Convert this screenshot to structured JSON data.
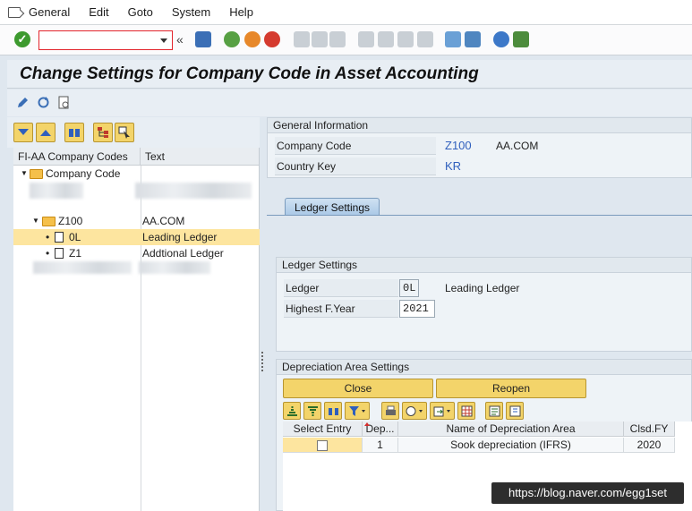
{
  "menu": [
    "General",
    "Edit",
    "Goto",
    "System",
    "Help"
  ],
  "command_field": {
    "value": ""
  },
  "title": "Change Settings for Company Code in Asset Accounting",
  "tree": {
    "headers": [
      "FI-AA Company Codes",
      "Text"
    ],
    "root_label": "Company Code",
    "nodes": [
      {
        "label": "Z100",
        "text": "AA.COM"
      },
      {
        "label": "0L",
        "text": "Leading Ledger"
      },
      {
        "label": "Z1",
        "text": "Addtional Ledger"
      }
    ]
  },
  "general_info": {
    "title": "General Information",
    "company_code_label": "Company Code",
    "company_code": "Z100",
    "company_name": "AA.COM",
    "country_key_label": "Country Key",
    "country_key": "KR"
  },
  "tab": {
    "label": "Ledger Settings"
  },
  "ledger_settings": {
    "title": "Ledger Settings",
    "ledger_label": "Ledger",
    "ledger_value": "0L",
    "ledger_text": "Leading Ledger",
    "fyear_label": "Highest F.Year",
    "fyear_value": "2021"
  },
  "depreciation": {
    "title": "Depreciation Area Settings",
    "close_label": "Close",
    "reopen_label": "Reopen",
    "columns": [
      "Select Entry",
      "Dep...",
      "Name of Depreciation Area",
      "Clsd.FY"
    ],
    "rows": [
      {
        "dep": "1",
        "name": "Sook depreciation (IFRS)",
        "clsd_fy": "2020"
      }
    ]
  },
  "watermark": "https://blog.naver.com/egg1set",
  "colors": {
    "accent_blue": "#2f5fbd",
    "button_yellow": "#f3d46a",
    "selection": "#fde59f"
  }
}
